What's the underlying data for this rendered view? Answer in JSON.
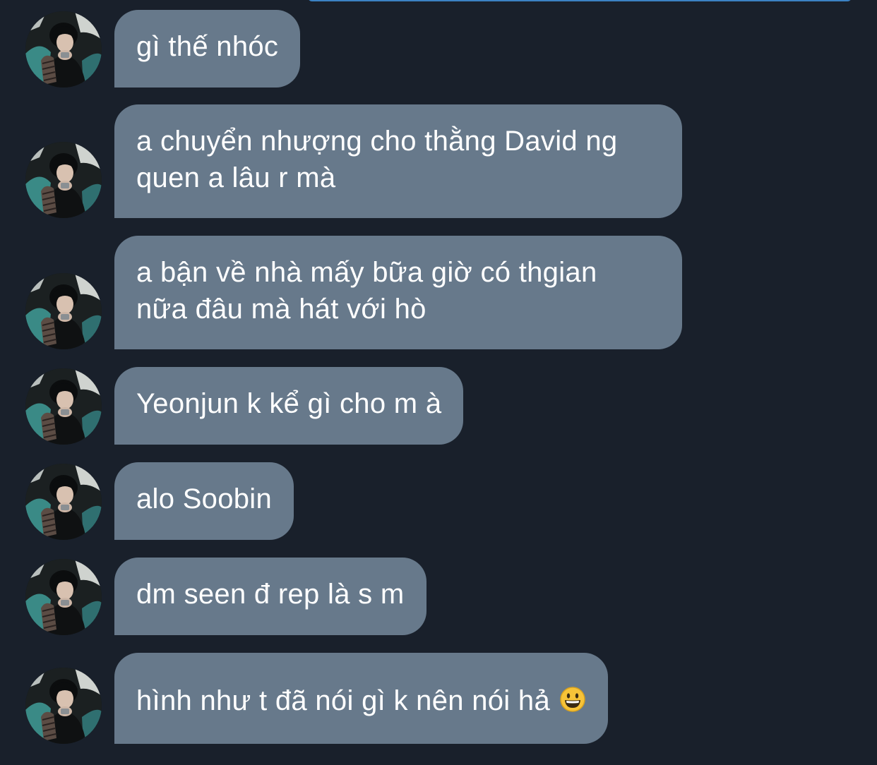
{
  "chat": {
    "sender_avatar": "avatar-photo",
    "messages": [
      {
        "text": "gì thế nhóc"
      },
      {
        "line1": "a chuyển nhượng cho thằng David ng",
        "line2": "quen a lâu r mà"
      },
      {
        "line1": "a bận về nhà mấy bữa giờ có thgian",
        "line2": "nữa đâu mà hát với hò"
      },
      {
        "text": "Yeonjun k kể gì cho m à"
      },
      {
        "text": "alo Soobin"
      },
      {
        "text": "dm seen đ rep là s m"
      },
      {
        "text": "hình như t đã nói gì k nên nói hả",
        "emoji": "grinning-face-icon"
      }
    ]
  },
  "colors": {
    "background": "#19202b",
    "bubble": "#67798b",
    "text": "#ffffff",
    "accent": "#3b82c4"
  }
}
